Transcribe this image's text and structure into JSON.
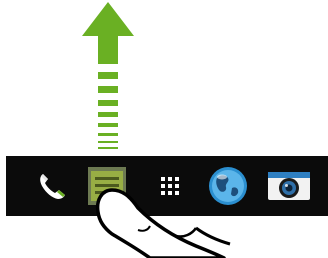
{
  "gesture": {
    "direction": "swipe-up",
    "arrow_icon": "up-arrow-icon",
    "hand_icon": "hand-pointer-icon",
    "arrow_color": "#6ab023"
  },
  "dock": {
    "background": "#0b0b0b",
    "items": [
      {
        "icon": "phone-icon",
        "selected": false
      },
      {
        "icon": "messages-icon",
        "selected": true
      },
      {
        "icon": "app-drawer-icon",
        "selected": false
      },
      {
        "icon": "browser-globe-icon",
        "selected": false
      },
      {
        "icon": "camera-icon",
        "selected": false
      }
    ]
  }
}
